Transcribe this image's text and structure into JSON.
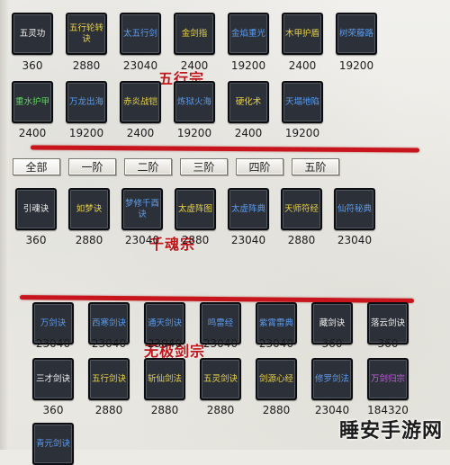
{
  "colors": {
    "cyan": "#4fd8e6",
    "yellow": "#e9d34a",
    "green": "#5fd35f",
    "blue": "#5a9cf0",
    "red": "#e0563a",
    "white": "#f2f2f2",
    "purple": "#c85ce8"
  },
  "wuxing": {
    "title": "五行宗",
    "row1": [
      {
        "name": "五灵功",
        "cost": "360",
        "color": "white"
      },
      {
        "name": "五行轮转诀",
        "cost": "2880",
        "color": "yellow"
      },
      {
        "name": "太五行剑",
        "cost": "23040",
        "color": "blue"
      },
      {
        "name": "金剑指",
        "cost": "2400",
        "color": "yellow"
      },
      {
        "name": "金焰重光",
        "cost": "19200",
        "color": "blue"
      },
      {
        "name": "木甲护盾",
        "cost": "2400",
        "color": "yellow"
      },
      {
        "name": "树荣藤路",
        "cost": "19200",
        "color": "blue"
      }
    ],
    "row2": [
      {
        "name": "重水护甲",
        "cost": "2400",
        "color": "green"
      },
      {
        "name": "万龙出海",
        "cost": "19200",
        "color": "blue"
      },
      {
        "name": "赤炎战铠",
        "cost": "2400",
        "color": "yellow"
      },
      {
        "name": "炼狱火海",
        "cost": "19200",
        "color": "blue"
      },
      {
        "name": "硬化术",
        "cost": "2400",
        "color": "yellow"
      },
      {
        "name": "天塌地陷",
        "cost": "19200",
        "color": "blue"
      }
    ]
  },
  "tabs": [
    "全部",
    "一阶",
    "二阶",
    "三阶",
    "四阶",
    "五阶"
  ],
  "qianhun": {
    "title": "千魂宗",
    "row1": [
      {
        "name": "引魂诀",
        "cost": "360",
        "color": "white"
      },
      {
        "name": "如梦诀",
        "cost": "2880",
        "color": "yellow"
      },
      {
        "name": "梦修千酉诀",
        "cost": "23040",
        "color": "blue"
      },
      {
        "name": "太虚阵图",
        "cost": "2880",
        "color": "yellow"
      },
      {
        "name": "太虚阵典",
        "cost": "23040",
        "color": "blue"
      },
      {
        "name": "天师符经",
        "cost": "2880",
        "color": "yellow"
      },
      {
        "name": "仙符秘典",
        "cost": "23040",
        "color": "blue"
      }
    ]
  },
  "wuji": {
    "title": "无极剑宗",
    "row1": [
      {
        "name": "万剑诀",
        "cost": "23040",
        "color": "blue"
      },
      {
        "name": "西寒剑诀",
        "cost": "23040",
        "color": "blue"
      },
      {
        "name": "通天剑诀",
        "cost": "23040",
        "color": "blue"
      },
      {
        "name": "鸣雷经",
        "cost": "23040",
        "color": "blue"
      },
      {
        "name": "紫霄雷典",
        "cost": "23040",
        "color": "blue"
      },
      {
        "name": "藏剑诀",
        "cost": "360",
        "color": "white"
      },
      {
        "name": "落云剑诀",
        "cost": "360",
        "color": "white"
      }
    ],
    "row2": [
      {
        "name": "三才剑诀",
        "cost": "360",
        "color": "white"
      },
      {
        "name": "五行剑诀",
        "cost": "2880",
        "color": "yellow"
      },
      {
        "name": "斩仙剑法",
        "cost": "2880",
        "color": "yellow"
      },
      {
        "name": "五灵剑诀",
        "cost": "2880",
        "color": "yellow"
      },
      {
        "name": "剑源心经",
        "cost": "2880",
        "color": "yellow"
      },
      {
        "name": "修罗剑法",
        "cost": "23040",
        "color": "blue"
      },
      {
        "name": "万剑归宗",
        "cost": "184320",
        "color": "purple"
      }
    ],
    "row3": [
      {
        "name": "青元剑诀",
        "cost": "",
        "color": "blue"
      }
    ]
  },
  "watermark": "睡安手游网"
}
